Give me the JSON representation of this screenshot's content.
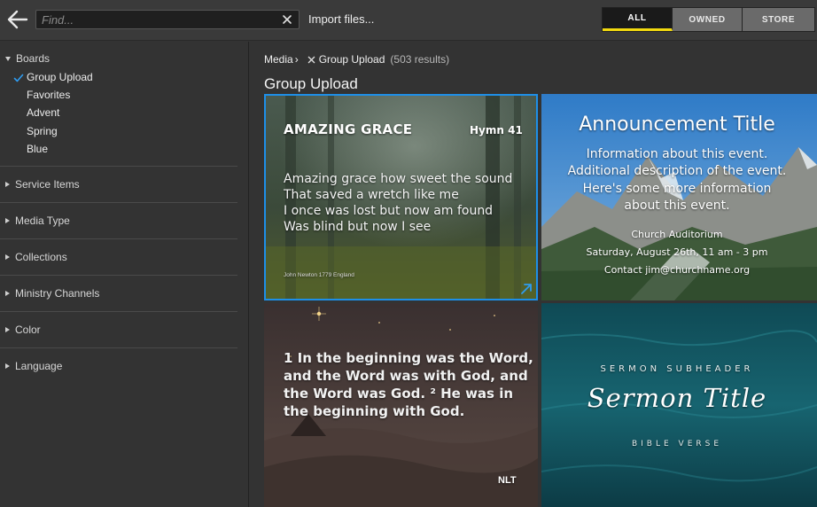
{
  "search": {
    "placeholder": "Find..."
  },
  "toolbar": {
    "import_label": "Import files..."
  },
  "filter": {
    "options": [
      "ALL",
      "OWNED",
      "STORE"
    ],
    "active": "ALL",
    "accent": "#f2d90f"
  },
  "sidebar": {
    "boards": {
      "label": "Boards",
      "expanded": true,
      "items": [
        "Group Upload",
        "Favorites",
        "Advent",
        "Spring",
        "Blue"
      ],
      "selected": "Group Upload"
    },
    "sections": [
      "Service Items",
      "Media Type",
      "Collections",
      "Ministry Channels",
      "Color",
      "Language"
    ]
  },
  "breadcrumb": {
    "root": "Media",
    "current": "Group Upload",
    "results": "(503 results)"
  },
  "main": {
    "title": "Group Upload"
  },
  "media": [
    {
      "heading": "AMAZING GRACE",
      "badge": "Hymn 41",
      "lines": [
        "Amazing grace how sweet the sound",
        "That saved a wretch like me",
        "I once was lost but now am found",
        "Was blind but now I see"
      ],
      "credit": "John Newton 1779 England",
      "selected": true,
      "selection_color": "#1e8fe8"
    },
    {
      "heading": "Announcement Title",
      "lines": [
        "Information about this event.",
        "Additional description of the event.",
        "Here's some more information",
        "about this event."
      ],
      "details": [
        "Church Auditorium",
        "Saturday, August 26th, 11 am - 3 pm",
        "Contact jim@churchname.org"
      ]
    },
    {
      "lines": [
        "1 In the beginning was the Word,",
        "and the Word was with God, and",
        "the Word was God. ² He was in",
        "the beginning with God."
      ],
      "version": "NLT"
    },
    {
      "subheader": "SERMON SUBHEADER",
      "heading": "Sermon Title",
      "footer": "BIBLE VERSE"
    }
  ]
}
